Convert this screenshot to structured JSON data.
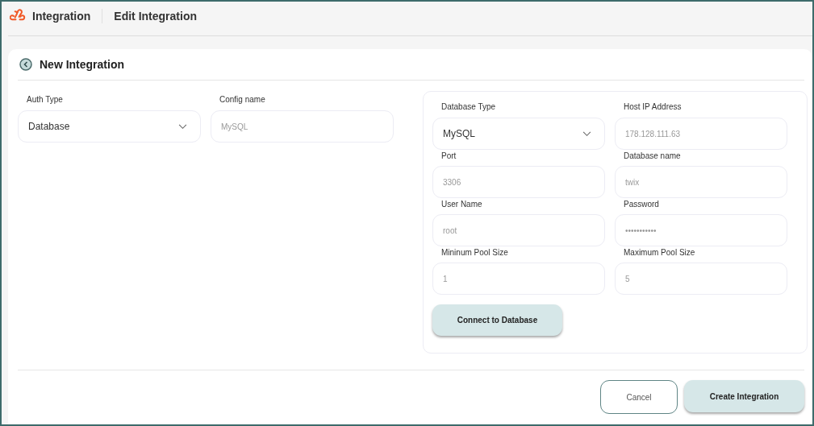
{
  "header": {
    "app_title": "Integration",
    "page_title": "Edit Integration"
  },
  "card": {
    "title": "New Integration"
  },
  "left_fields": [
    {
      "label": "Auth Type",
      "kind": "select",
      "value": "Database"
    },
    {
      "label": "Config name",
      "kind": "input",
      "value": "MySQL"
    }
  ],
  "db_fields": [
    {
      "label": "Database Type",
      "kind": "select",
      "value": "MySQL"
    },
    {
      "label": "Host IP Address",
      "kind": "input",
      "value": "178.128.111.63"
    },
    {
      "label": "Port",
      "kind": "input",
      "value": "3306"
    },
    {
      "label": "Database name",
      "kind": "input",
      "value": "twix"
    },
    {
      "label": "User Name",
      "kind": "input",
      "value": "root"
    },
    {
      "label": "Password",
      "kind": "input",
      "value": "•••••••••••"
    },
    {
      "label": "Mininum Pool Size",
      "kind": "input",
      "value": "1"
    },
    {
      "label": "Maximum Pool Size",
      "kind": "input",
      "value": "5"
    }
  ],
  "connect_button": "Connect to Database",
  "buttons": {
    "cancel": "Cancel",
    "create": "Create Integration"
  }
}
